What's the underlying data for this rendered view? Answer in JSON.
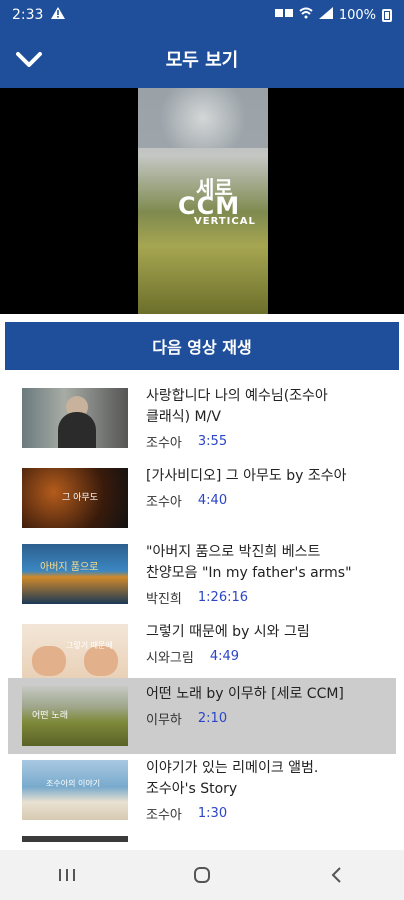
{
  "status": {
    "time": "2:33",
    "right_text": "100%",
    "icons": [
      "warning-icon",
      "data-icon",
      "wifi-icon",
      "signal-icon",
      "battery-icon"
    ]
  },
  "header": {
    "title": "모두 보기"
  },
  "video": {
    "title_small": "세로",
    "title_large": "CCM",
    "title_sub": "VERTICAL"
  },
  "next_bar": {
    "label": "다음 영상 재생"
  },
  "list": [
    {
      "title_line1": "사랑합니다 나의 예수님(조수아",
      "title_line2": "클래식) M/V",
      "author": "조수아",
      "duration": "3:55",
      "thumb": "portrait-forest"
    },
    {
      "title_line1": "[가사비디오] 그 아무도 by 조수아",
      "title_line2": "",
      "author": "조수아",
      "duration": "4:40",
      "thumb": "dark-orange"
    },
    {
      "title_line1": "\"아버지 품으로 박진희 베스트",
      "title_line2": "찬양모음 \"In my father's arms\"",
      "author": "박진희",
      "duration": "1:26:16",
      "thumb": "sunset-sea"
    },
    {
      "title_line1": "그렇기 때문에 by 시와 그림",
      "title_line2": "",
      "author": "시와그림",
      "duration": "4:49",
      "thumb": "hands"
    },
    {
      "title_line1": "어떤 노래 by 이무하 [세로 CCM]",
      "title_line2": "",
      "author": "이무하",
      "duration": "2:10",
      "thumb": "field",
      "active": true
    },
    {
      "title_line1": "이야기가 있는 리메이크 앨범.",
      "title_line2": "조수아's Story",
      "author": "조수아",
      "duration": "1:30",
      "thumb": "beach"
    }
  ],
  "colors": {
    "primary": "#1f4f9a",
    "duration": "#2b45c6",
    "active_row": "#cccccc"
  }
}
